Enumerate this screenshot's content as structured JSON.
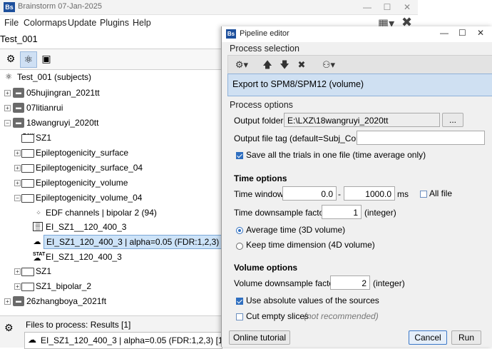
{
  "main_window": {
    "title": "Brainstorm 07-Jan-2025",
    "menu": [
      "File",
      "Colormaps",
      "Update",
      "Plugins",
      "Help"
    ],
    "protocol": "Test_001",
    "tree": {
      "root": "Test_001 (subjects)",
      "subjects": [
        "05hujingran_2021tt",
        "07litianrui",
        "18wangruyi_2020tt",
        "26zhangboya_2021ft"
      ],
      "items": [
        "SZ1",
        "Epileptogenicity_surface",
        "Epileptogenicity_surface_04",
        "Epileptogenicity_volume",
        "Epileptogenicity_volume_04",
        "EDF channels  | bipolar 2 (94)",
        "EI_SZ1__120_400_3",
        "EI_SZ1_120_400_3 | alpha=0.05 (FDR:1,2,3)",
        "EI_SZ1_120_400_3",
        "SZ1",
        "SZ1_bipolar_2"
      ],
      "raw_badge": "RAW",
      "stat_badge": "STAT"
    },
    "files_panel": {
      "header": "Files to process: Results [1]",
      "item": "EI_SZ1_120_400_3 | alpha=0.05 (FDR:1,2,3) [1]"
    }
  },
  "dialog": {
    "title": "Pipeline editor",
    "process_selection_label": "Process selection",
    "selected_process": "Export to SPM8/SPM12 (volume)",
    "process_options_label": "Process options",
    "output_folder_label": "Output folder:",
    "output_folder_value": "E:\\LXZ\\18wangruyi_2020tt",
    "browse_label": "...",
    "output_tag_label": "Output file tag (default=Subj_Cond):",
    "output_tag_value": "",
    "save_all_label": "Save all the trials in one file (time average only)",
    "time_options_label": "Time options",
    "time_window_label": "Time window:",
    "time_start": "0.0",
    "time_dash": "-",
    "time_end": "1000.0",
    "time_unit": "ms",
    "all_file_label": "All file",
    "time_downsample_label": "Time downsample factor:",
    "time_downsample_value": "1",
    "integer_unit": "(integer)",
    "average_time_label": "Average time (3D volume)",
    "keep_time_label": "Keep time dimension (4D volume)",
    "volume_options_label": "Volume options",
    "volume_downsample_label": "Volume downsample factor:",
    "volume_downsample_value": "2",
    "abs_values_label": "Use absolute values of the sources",
    "cut_empty_label": "Cut empty slices",
    "cut_empty_note": "(not recommended)",
    "tutorial_label": "Online tutorial",
    "cancel_label": "Cancel",
    "run_label": "Run"
  },
  "colors": {
    "selection": "#cfe0f2",
    "accent": "#2f6fc0"
  }
}
